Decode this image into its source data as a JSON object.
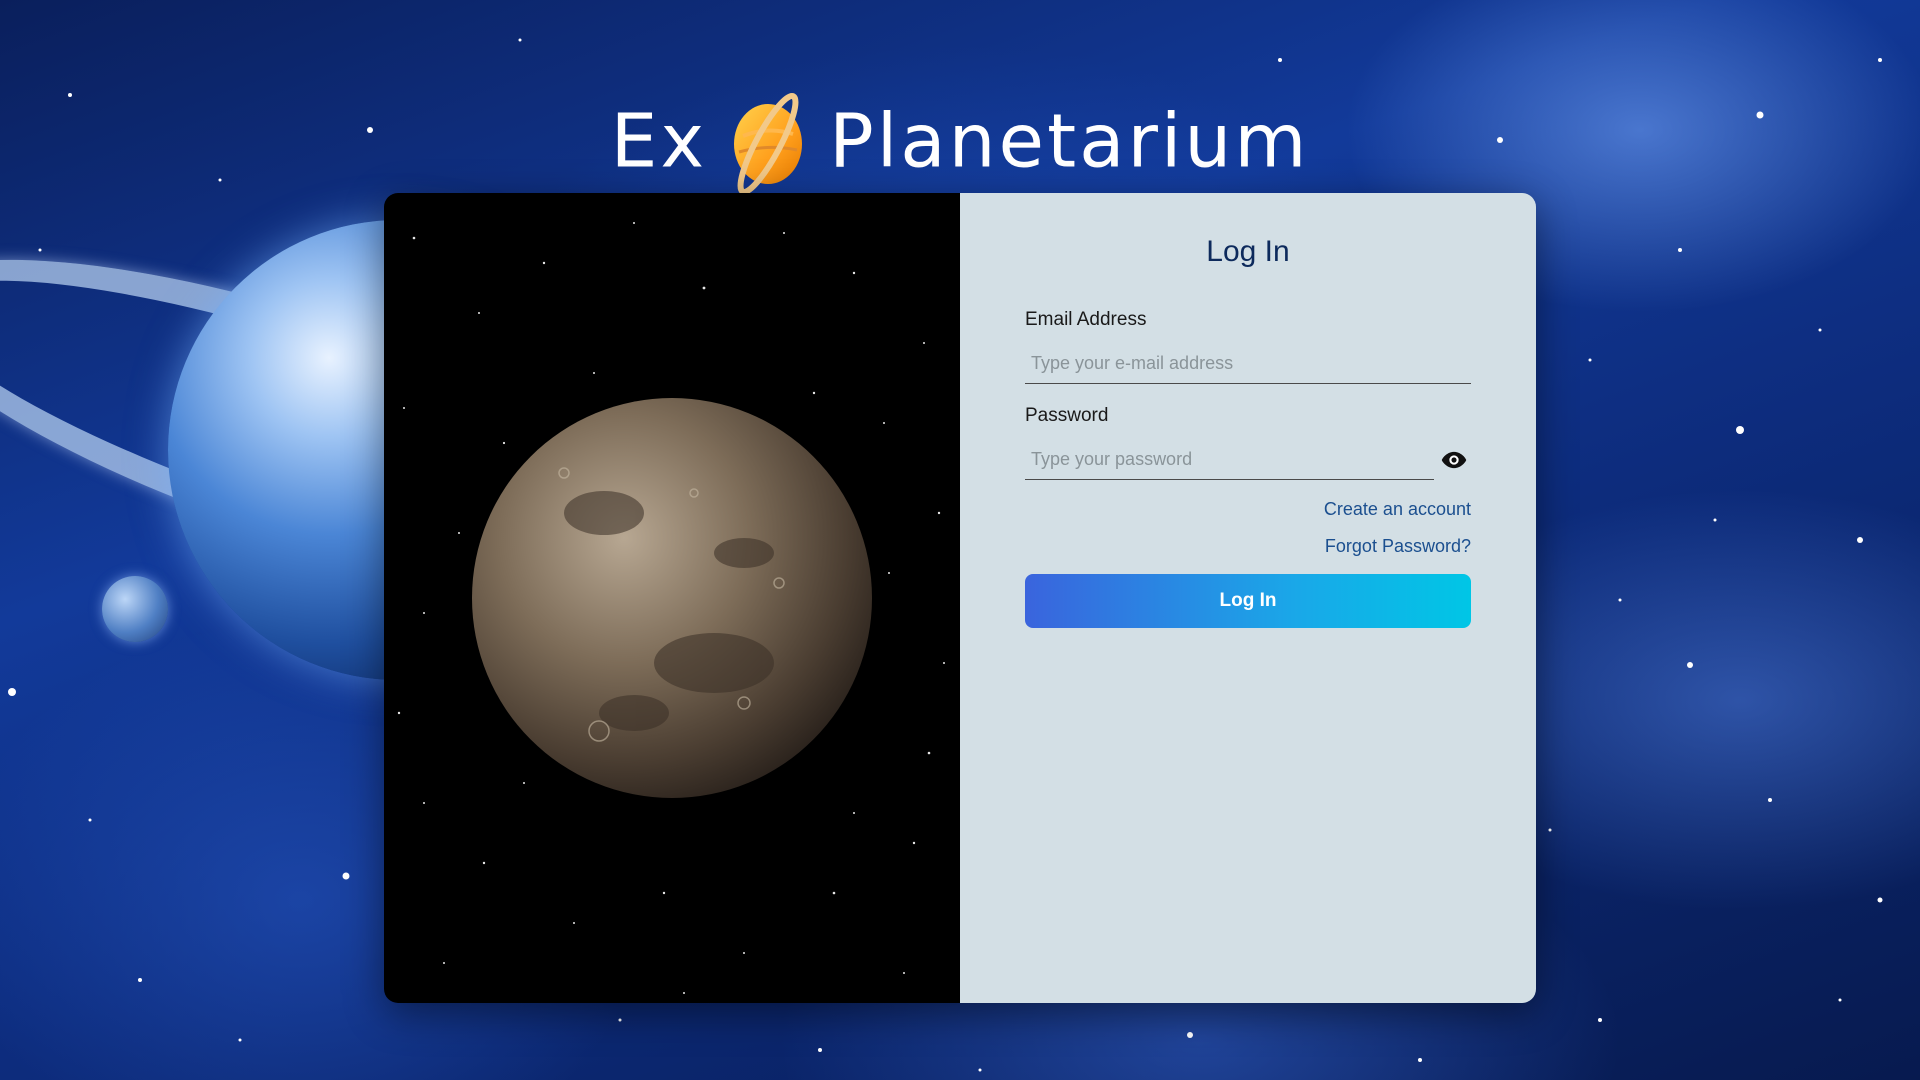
{
  "logo": {
    "left_word": "Ex",
    "right_word": "Planetarium"
  },
  "login": {
    "title": "Log In",
    "email_label": "Email Address",
    "email_placeholder": "Type your e-mail address",
    "email_value": "",
    "password_label": "Password",
    "password_placeholder": "Type your password",
    "password_value": "",
    "create_account_link": "Create an account",
    "forgot_password_link": "Forgot Password?",
    "submit_label": "Log In"
  },
  "icons": {
    "password_toggle": "eye-icon",
    "logo_planet": "ringed-planet-icon"
  },
  "colors": {
    "title": "#0d2a5c",
    "link": "#1b4f8f",
    "button_start": "#3a64dd",
    "button_end": "#00c6e6",
    "panel": "#d3dfe5"
  }
}
